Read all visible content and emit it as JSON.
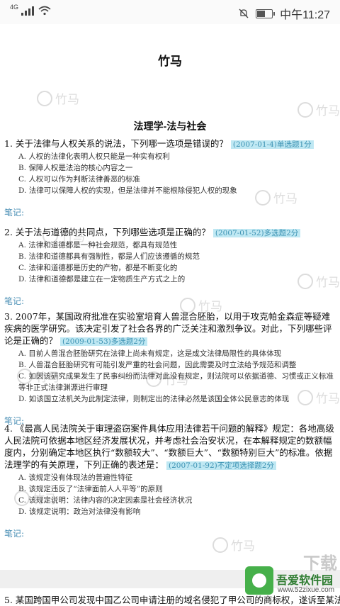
{
  "status": {
    "network": "4G",
    "time": "中午11:27"
  },
  "doc": {
    "title": "竹马",
    "section": "法理学-法与社会",
    "watermark": "竹马",
    "questions": [
      {
        "stem": "1. 关于法律与人权关系的说法，下列哪一选项是错误的？",
        "tag": "(2007-01-4)单选题1分",
        "options": [
          "A. 人权的法律化表明人权只能是一种实有权利",
          "B. 保障人权是法治的核心内容之一",
          "C. 人权可以作为判断法律善恶的标准",
          "D. 法律可以保障人权的实现，但是法律并不能根除侵犯人权的现象"
        ],
        "note": "笔记:"
      },
      {
        "stem": "2. 关于法与道德的共同点，下列哪些选项是正确的？",
        "tag": "(2007-01-52)多选题2分",
        "options": [
          "A. 法律和道德都是一种社会规范，都具有规范性",
          "B. 法律和道德都具有强制性，都是人们应该遵循的规范",
          "C. 法律和道德都是历史的产物，都是不断变化的",
          "D. 法律和道德都是建立在一定物质生产方式之上的"
        ],
        "note": "笔记:"
      },
      {
        "stem": "3. 2007年，某国政府批准在实验室培育人兽混合胚胎，以用于攻克帕金森症等疑难疾病的医学研究。该决定引发了社会各界的广泛关注和激烈争议。对此，下列哪些评论是正确的？",
        "tag": "(2009-01-53)多选题2分",
        "options": [
          "A. 目前人兽混合胚胎研究在法律上尚未有规定，这是成文法律局限性的具体体现",
          "B. 人兽混合胚胎研究有可能引发严重的社会问题，因此需要及时立法给予规范和调整",
          "C. 如因该研究成果发生了民事纠纷而法律对此没有规定，则法院可以依据道德、习惯或正义标准等非正式法律渊源进行审理",
          "D. 如该国立法机关为此制定法律，则制定出的法律必然是该国全体公民意志的体现"
        ],
        "note": "笔记:"
      },
      {
        "stem": "4. 《最高人民法院关于审理盗窃案件具体应用法律若干问题的解释》规定：各地高级人民法院可依据本地区经济发展状况，并考虑社会治安状况，在本解释规定的数额幅度内，分别确定本地区执行“数额较大”、“数额巨大”、“数额特别巨大”的标准。依据法理学的有关原理，下列正确的表述是：",
        "tag": "(2007-01-92)不定项选择题2分",
        "options": [
          "A. 该规定没有体现法的普遍性特征",
          "B. 该规定违反了“法律面前人人平等”的原则",
          "C. 该规定说明：法律内容的决定因素是社会经济状况",
          "D. 该规定说明：政治对法律没有影响"
        ],
        "note": "笔记:"
      }
    ],
    "q5_preview": "5. 某国跨国甲公司发现中国乙公司申请注册的域名侵犯了甲公司的商标权，遂诉至某法院"
  },
  "overlay": {
    "brand": "吾爱软件园",
    "url": "www.52zixue.com",
    "big": "下载"
  }
}
